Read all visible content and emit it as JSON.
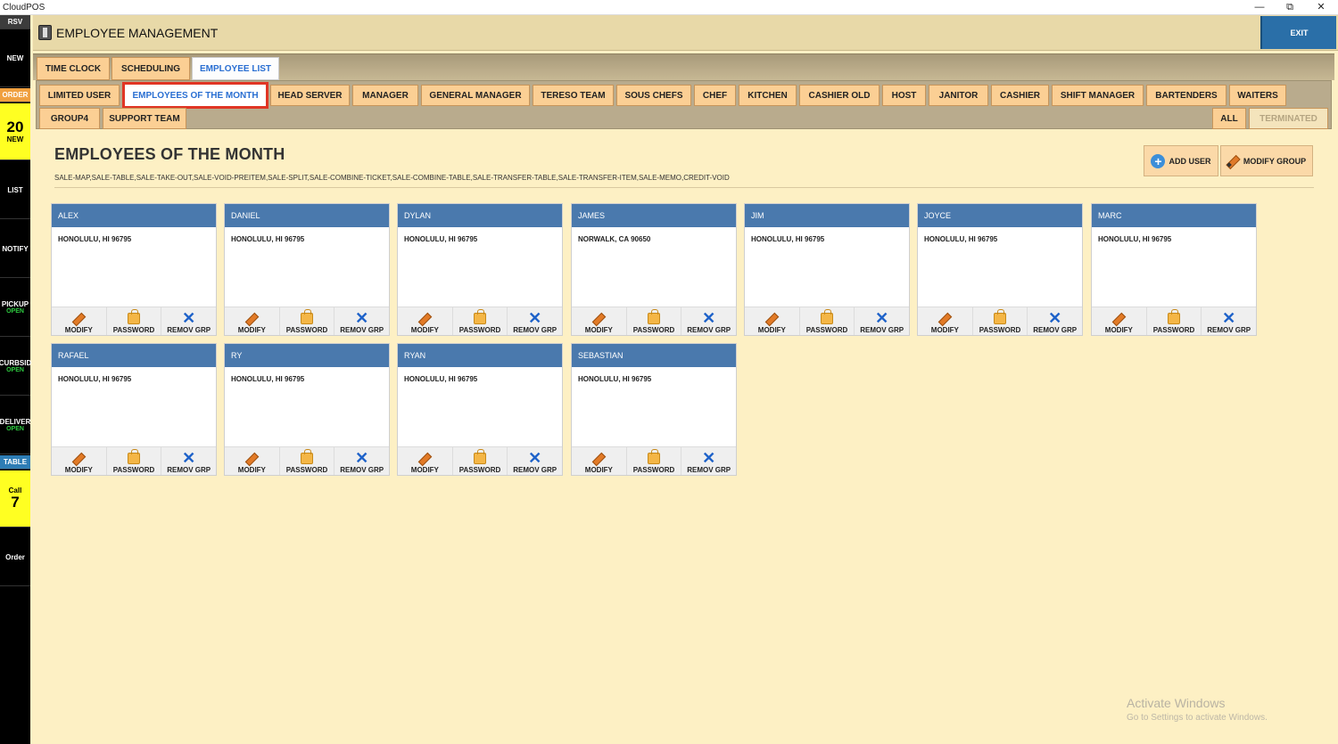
{
  "os": {
    "title": "CloudPOS",
    "min": "—",
    "max": "⧉",
    "close": "✕"
  },
  "rail": {
    "rsv": "RSV",
    "new": "NEW",
    "order": "ORDER",
    "order_count": "20",
    "order_count_label": "NEW",
    "list": "LIST",
    "notify": "NOTIFY",
    "pickup": "PICKUP",
    "pickup_status": "OPEN",
    "curbside": "CURBSID",
    "curbside_status": "OPEN",
    "delivery": "DELIVER",
    "delivery_status": "OPEN",
    "table": "TABLE",
    "call_label": "Call",
    "call_count": "7",
    "order2": "Order"
  },
  "header": {
    "title": "EMPLOYEE MANAGEMENT",
    "exit": "EXIT"
  },
  "top_tabs": [
    "TIME CLOCK",
    "SCHEDULING",
    "EMPLOYEE LIST"
  ],
  "groups_row1": [
    "LIMITED USER",
    "EMPLOYEES OF THE MONTH",
    "HEAD SERVER",
    "MANAGER",
    "GENERAL MANAGER",
    "TERESO TEAM",
    "SOUS CHEFS",
    "CHEF",
    "KITCHEN",
    "CASHIER OLD",
    "HOST",
    "JANITOR",
    "CASHIER",
    "SHIFT MANAGER",
    "BARTENDERS",
    "WAITERS"
  ],
  "groups_row2": [
    "GROUP4",
    "SUPPORT TEAM"
  ],
  "filters": {
    "all": "ALL",
    "terminated": "TERMINATED"
  },
  "main": {
    "title": "EMPLOYEES OF THE MONTH",
    "permissions": "SALE-MAP,SALE-TABLE,SALE-TAKE-OUT,SALE-VOID-PREITEM,SALE-SPLIT,SALE-COMBINE-TICKET,SALE-COMBINE-TABLE,SALE-TRANSFER-TABLE,SALE-TRANSFER-ITEM,SALE-MEMO,CREDIT-VOID",
    "add_user": "ADD USER",
    "modify_group": "MODIFY GROUP"
  },
  "card_actions": {
    "modify": "MODIFY",
    "password": "PASSWORD",
    "remove": "REMOV GRP"
  },
  "employees": [
    {
      "name": "ALEX",
      "address": "HONOLULU, HI 96795"
    },
    {
      "name": "DANIEL",
      "address": "HONOLULU, HI 96795"
    },
    {
      "name": "DYLAN",
      "address": "HONOLULU, HI 96795"
    },
    {
      "name": "JAMES",
      "address": "NORWALK, CA 90650"
    },
    {
      "name": "JIM",
      "address": "HONOLULU, HI 96795"
    },
    {
      "name": "JOYCE",
      "address": "HONOLULU, HI 96795"
    },
    {
      "name": "MARC",
      "address": "HONOLULU, HI 96795"
    },
    {
      "name": "RAFAEL",
      "address": "HONOLULU, HI 96795"
    },
    {
      "name": "RY",
      "address": "HONOLULU, HI 96795"
    },
    {
      "name": "RYAN",
      "address": "HONOLULU, HI 96795"
    },
    {
      "name": "SEBASTIAN",
      "address": "HONOLULU, HI 96795"
    }
  ],
  "watermark": {
    "line1": "Activate Windows",
    "line2": "Go to Settings to activate Windows."
  },
  "colors": {
    "accent": "#2a6fa8",
    "card_header": "#4a79ad",
    "tab": "#fbcf94",
    "background": "#fdf0c4",
    "active_outline": "#e03524"
  }
}
